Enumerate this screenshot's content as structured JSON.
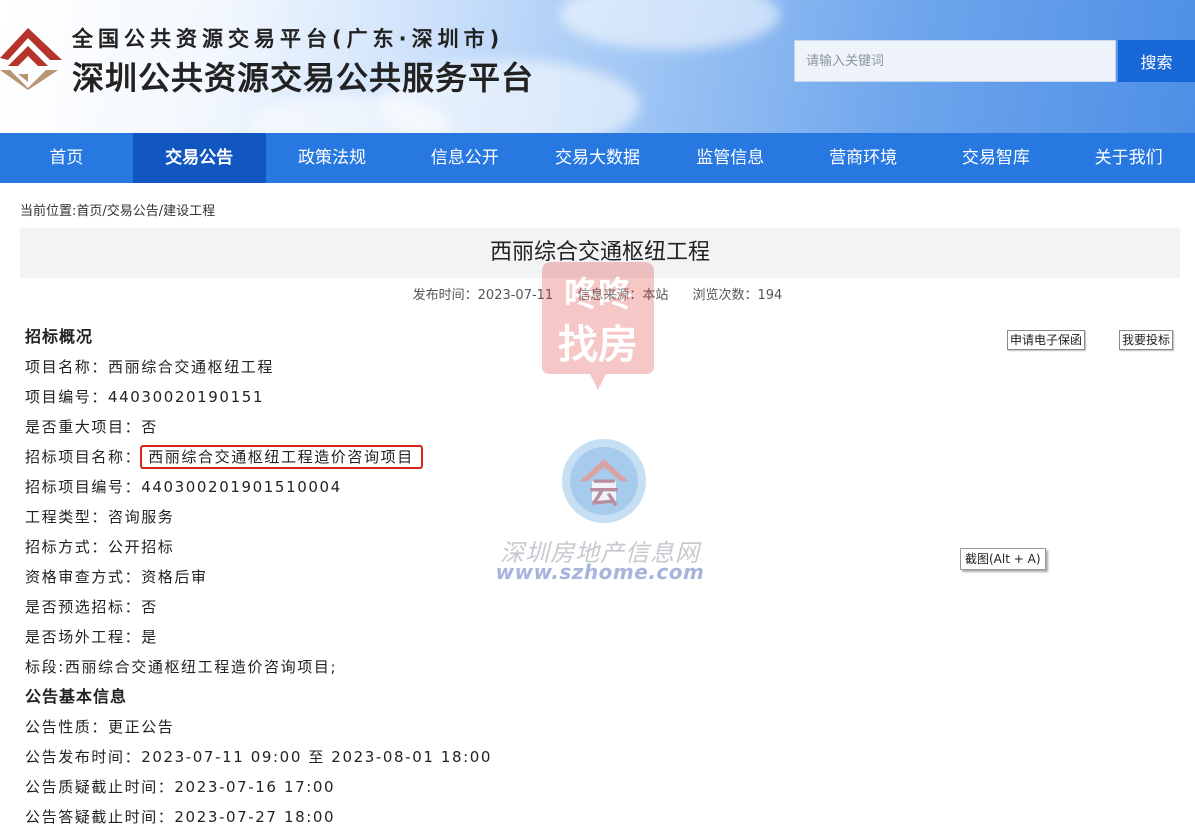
{
  "header": {
    "subtitle": "全国公共资源交易平台(广东·深圳市)",
    "title": "深圳公共资源交易公共服务平台",
    "search_placeholder": "请输入关键词",
    "search_button": "搜索"
  },
  "nav": {
    "items": [
      {
        "label": "首页"
      },
      {
        "label": "交易公告",
        "active": true
      },
      {
        "label": "政策法规"
      },
      {
        "label": "信息公开"
      },
      {
        "label": "交易大数据"
      },
      {
        "label": "监管信息"
      },
      {
        "label": "营商环境"
      },
      {
        "label": "交易智库"
      },
      {
        "label": "关于我们"
      }
    ]
  },
  "breadcrumb": "当前位置:首页/交易公告/建设工程",
  "article": {
    "title": "西丽综合交通枢纽工程",
    "publish_time": "发布时间：2023-07-11",
    "source": "信息来源：本站",
    "views": "浏览次数：194"
  },
  "actions": {
    "guarantee": "申请电子保函",
    "bid": "我要投标"
  },
  "tooltip": "截图(Alt + A)",
  "section1": {
    "heading": "招标概况",
    "project_name": "项目名称：西丽综合交通枢纽工程",
    "project_no": "项目编号：44030020190151",
    "major": "是否重大项目：否",
    "bid_name_label": "招标项目名称：",
    "bid_name_value": "西丽综合交通枢纽工程造价咨询项目",
    "bid_no": "招标项目编号：440300201901510004",
    "type": "工程类型：咨询服务",
    "method": "招标方式：公开招标",
    "review": "资格审查方式：资格后审",
    "preselect": "是否预选招标：否",
    "offsite": "是否场外工程：是",
    "lot": "标段:西丽综合交通枢纽工程造价咨询项目;"
  },
  "section2": {
    "heading": "公告基本信息",
    "nature": "公告性质：更正公告",
    "publish_period": "公告发布时间：2023-07-11 09:00 至 2023-08-01 18:00",
    "query_deadline": "公告质疑截止时间：2023-07-16 17:00",
    "answer_deadline": "公告答疑截止时间：2023-07-27 18:00"
  },
  "watermarks": {
    "top_text1": "咚咚",
    "top_text2": "找房",
    "center_cn": "深圳房地产信息网",
    "center_en": "www.szhome.com"
  },
  "colors": {
    "nav": "#2878e1",
    "nav_active": "#1256c2",
    "search_button": "#1768d6",
    "highlight": "#d8261c",
    "logo_red": "#b5342b",
    "logo_tan": "#b89472"
  }
}
